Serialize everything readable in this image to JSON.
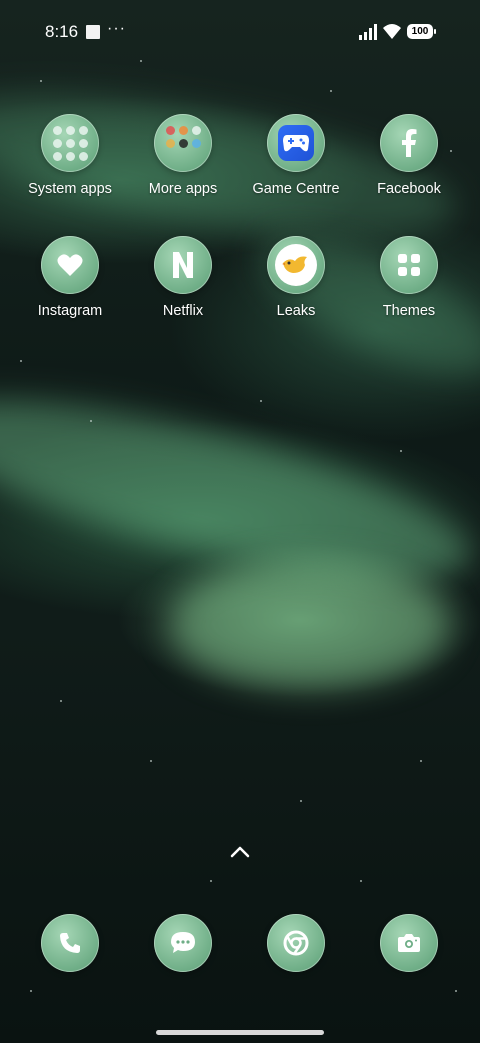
{
  "status_bar": {
    "time": "8:16",
    "battery": "100",
    "icons": [
      "notification-square-icon",
      "more-dots-icon",
      "signal-icon",
      "wifi-icon",
      "battery-icon"
    ]
  },
  "apps": [
    {
      "label": "System apps",
      "icon": "folder-icon"
    },
    {
      "label": "More apps",
      "icon": "folder-icon"
    },
    {
      "label": "Game Centre",
      "icon": "gamepad-icon"
    },
    {
      "label": "Facebook",
      "icon": "facebook-icon"
    },
    {
      "label": "Instagram",
      "icon": "heart-icon"
    },
    {
      "label": "Netflix",
      "icon": "netflix-icon"
    },
    {
      "label": "Leaks",
      "icon": "bird-icon"
    },
    {
      "label": "Themes",
      "icon": "themes-icon"
    }
  ],
  "dock": [
    {
      "name": "Phone",
      "icon": "phone-icon"
    },
    {
      "name": "Messages",
      "icon": "messages-icon"
    },
    {
      "name": "Chrome",
      "icon": "chrome-icon"
    },
    {
      "name": "Camera",
      "icon": "camera-icon"
    }
  ],
  "colors": {
    "icon_green": "#7fbf98",
    "wallpaper_dark": "#0e1a17",
    "game_centre_blue": "#2f6df5"
  }
}
